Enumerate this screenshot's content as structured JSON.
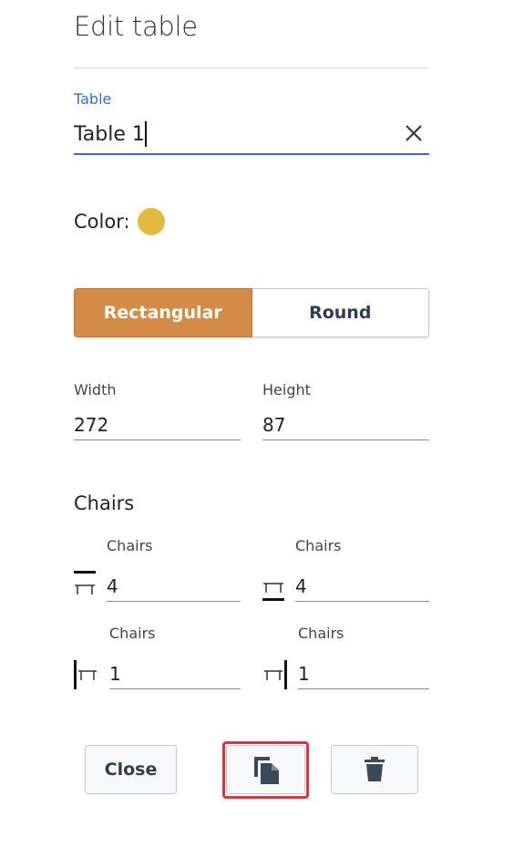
{
  "header": {
    "title": "Edit table"
  },
  "name_field": {
    "label": "Table",
    "value": "Table 1",
    "clear_icon": "close-icon"
  },
  "color": {
    "label": "Color:",
    "swatch": "#e5b83f"
  },
  "shape": {
    "options": [
      "Rectangular",
      "Round"
    ],
    "selected": "Rectangular"
  },
  "dimensions": {
    "width_label": "Width",
    "width_value": "272",
    "height_label": "Height",
    "height_value": "87"
  },
  "chairs": {
    "heading": "Chairs",
    "top": {
      "label": "Chairs",
      "value": "4",
      "icon": "chair-top-icon"
    },
    "bottom": {
      "label": "Chairs",
      "value": "4",
      "icon": "chair-bottom-icon"
    },
    "left": {
      "label": "Chairs",
      "value": "1",
      "icon": "chair-left-icon"
    },
    "right": {
      "label": "Chairs",
      "value": "1",
      "icon": "chair-right-icon"
    }
  },
  "footer": {
    "close_label": "Close",
    "duplicate_icon": "duplicate-icon",
    "delete_icon": "trash-icon"
  },
  "colors": {
    "accent_blue": "#3b6ccc",
    "segment_active": "#d48b47",
    "highlight": "#d9363e"
  }
}
